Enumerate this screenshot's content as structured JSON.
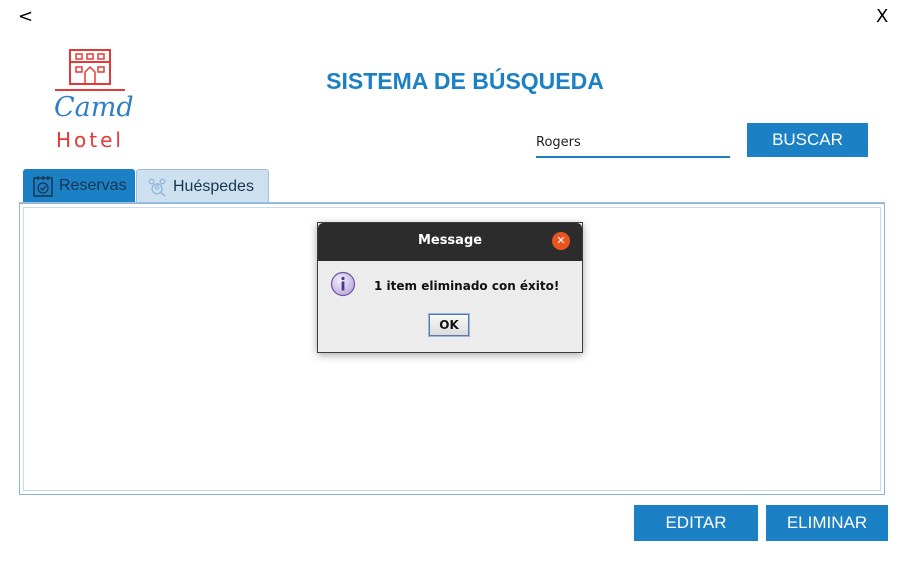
{
  "window": {
    "back_label": "<",
    "close_label": "X"
  },
  "logo": {
    "line1": "Camd",
    "line2": "Hotel"
  },
  "header": {
    "title": "SISTEMA DE BÚSQUEDA"
  },
  "search": {
    "value": "Rogers",
    "button_label": "BUSCAR"
  },
  "tabs": [
    {
      "label": "Reservas",
      "icon": "calendar-check-icon"
    },
    {
      "label": "Huéspedes",
      "icon": "guests-search-icon"
    }
  ],
  "dialog": {
    "title": "Message",
    "message": "1 item eliminado con éxito!",
    "ok_label": "OK",
    "icon": "info-icon"
  },
  "actions": {
    "edit_label": "EDITAR",
    "delete_label": "ELIMINAR"
  },
  "colors": {
    "accent": "#1b80c4",
    "brand_red": "#e53935",
    "dialog_close": "#e95420"
  }
}
